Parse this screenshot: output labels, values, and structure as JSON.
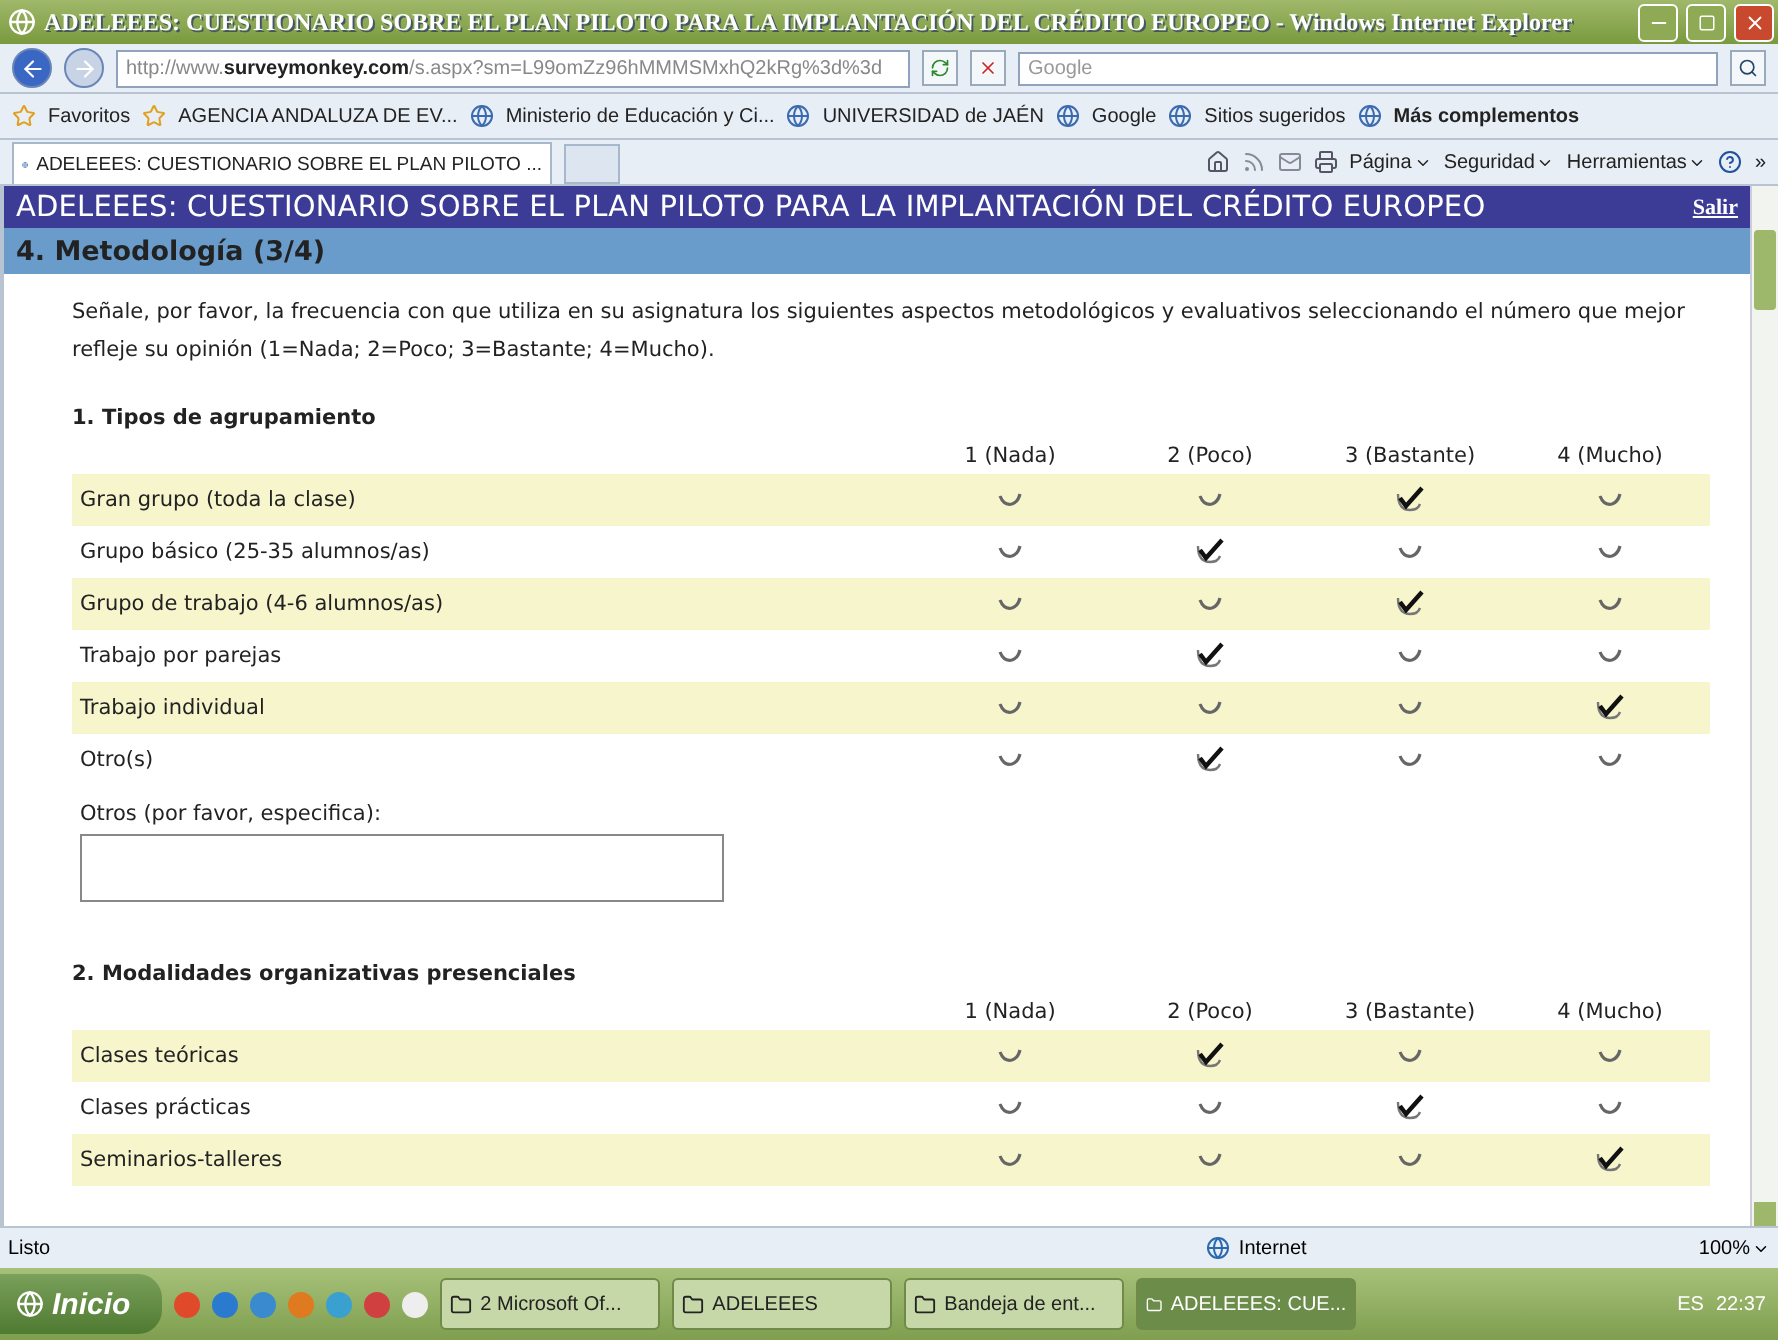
{
  "window": {
    "title": "ADELEEES: CUESTIONARIO SOBRE EL PLAN PILOTO PARA LA IMPLANTACIÓN DEL CRÉDITO EUROPEO - Windows Internet Explorer"
  },
  "browser": {
    "address": "http://www.**surveymonkey.com**/s.aspx?sm=L99omZz96hMMMSMxhQ2kRg%3d%3d",
    "search_placeholder": "Google",
    "favorites": [
      "Favoritos",
      "AGENCIA ANDALUZA DE EV...",
      "Ministerio de Educación y Ci...",
      "UNIVERSIDAD de JAÉN",
      "Google",
      "Sitios sugeridos",
      "Más complementos"
    ],
    "tab": "ADELEEES: CUESTIONARIO SOBRE EL PLAN PILOTO ...",
    "commands": [
      "Página",
      "Seguridad",
      "Herramientas"
    ],
    "overflow": "»"
  },
  "page": {
    "title": "ADELEEES: CUESTIONARIO SOBRE EL PLAN PILOTO PARA LA IMPLANTACIÓN DEL CRÉDITO EUROPEO",
    "exit": "Salir",
    "section": "4. Metodología (3/4)",
    "intro": "Señale, por favor, la frecuencia con que utiliza en su asignatura los siguientes aspectos metodológicos y evaluativos seleccionando el número que mejor refleje su opinión (1=Nada; 2=Poco; 3=Bastante; 4=Mucho).",
    "questions": [
      {
        "title": "1. Tipos de agrupamiento",
        "columns": [
          "1 (Nada)",
          "2 (Poco)",
          "3 (Bastante)",
          "4 (Mucho)"
        ],
        "rows": [
          {
            "label": "Gran grupo (toda la clase)",
            "choices": [
              {
                "selected": false
              },
              {
                "selected": false
              },
              {
                "selected": true
              },
              {
                "selected": false
              }
            ]
          },
          {
            "label": "Grupo básico (25-35 alumnos/as)",
            "choices": [
              {
                "selected": false
              },
              {
                "selected": true
              },
              {
                "selected": false
              },
              {
                "selected": false
              }
            ]
          },
          {
            "label": "Grupo de trabajo (4-6 alumnos/as)",
            "choices": [
              {
                "selected": false
              },
              {
                "selected": false
              },
              {
                "selected": true
              },
              {
                "selected": false
              }
            ]
          },
          {
            "label": "Trabajo por parejas",
            "choices": [
              {
                "selected": false
              },
              {
                "selected": true
              },
              {
                "selected": false
              },
              {
                "selected": false
              }
            ]
          },
          {
            "label": "Trabajo individual",
            "choices": [
              {
                "selected": false
              },
              {
                "selected": false
              },
              {
                "selected": false
              },
              {
                "selected": true
              }
            ]
          },
          {
            "label": "Otro(s)",
            "choices": [
              {
                "selected": false
              },
              {
                "selected": true
              },
              {
                "selected": false
              },
              {
                "selected": false
              }
            ]
          }
        ],
        "other_label": "Otros (por favor, especifica):"
      },
      {
        "title": "2. Modalidades organizativas presenciales",
        "columns": [
          "1 (Nada)",
          "2 (Poco)",
          "3 (Bastante)",
          "4 (Mucho)"
        ],
        "rows": [
          {
            "label": "Clases teóricas",
            "choices": [
              {
                "selected": false
              },
              {
                "selected": true
              },
              {
                "selected": false
              },
              {
                "selected": false
              }
            ]
          },
          {
            "label": "Clases prácticas",
            "choices": [
              {
                "selected": false
              },
              {
                "selected": false
              },
              {
                "selected": true
              },
              {
                "selected": false
              }
            ]
          },
          {
            "label": "Seminarios-talleres",
            "choices": [
              {
                "selected": false
              },
              {
                "selected": false
              },
              {
                "selected": false
              },
              {
                "selected": true
              }
            ]
          }
        ]
      }
    ]
  },
  "status_bar": {
    "status": "Listo",
    "zone": "Internet",
    "zoom": "100%"
  },
  "taskbar": {
    "start": "Inicio",
    "tasks": [
      {
        "label": "2 Microsoft Of...",
        "selected": false
      },
      {
        "label": "ADELEEES",
        "selected": false
      },
      {
        "label": "Bandeja de ent...",
        "selected": false
      },
      {
        "label": "ADELEEES: CUE...",
        "selected": true
      }
    ],
    "language": "ES",
    "time": "22:37"
  }
}
